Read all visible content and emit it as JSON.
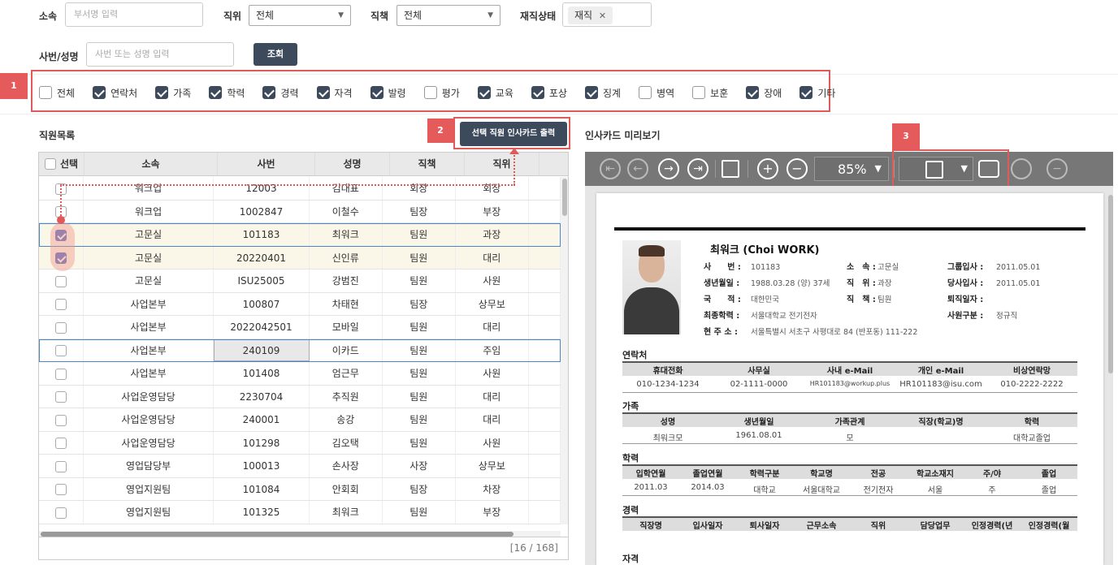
{
  "search": {
    "dept_label": "소속",
    "dept_placeholder": "부서명 입력",
    "position_label": "직위",
    "position_value": "전체",
    "duty_label": "직책",
    "duty_value": "전체",
    "status_label": "재직상태",
    "status_chip": "재직",
    "status_chip_close": "✕",
    "emp_label": "사번/성명",
    "emp_placeholder": "사번 또는 성명 입력",
    "search_button": "조회"
  },
  "filters": [
    {
      "label": "전체",
      "checked": false
    },
    {
      "label": "연락처",
      "checked": true
    },
    {
      "label": "가족",
      "checked": true
    },
    {
      "label": "학력",
      "checked": true
    },
    {
      "label": "경력",
      "checked": true
    },
    {
      "label": "자격",
      "checked": true
    },
    {
      "label": "발령",
      "checked": true
    },
    {
      "label": "평가",
      "checked": false
    },
    {
      "label": "교육",
      "checked": true
    },
    {
      "label": "포상",
      "checked": true
    },
    {
      "label": "징계",
      "checked": true
    },
    {
      "label": "병역",
      "checked": false
    },
    {
      "label": "보훈",
      "checked": false
    },
    {
      "label": "장애",
      "checked": true
    },
    {
      "label": "기타",
      "checked": true
    }
  ],
  "callouts": {
    "one": "1",
    "two": "2",
    "three": "3"
  },
  "list": {
    "title": "직원목록",
    "print_button": "선택 직원 인사카드 출력",
    "columns": [
      "선택",
      "소속",
      "사번",
      "성명",
      "직책",
      "직위"
    ],
    "rows": [
      {
        "dept": "워크업",
        "id": "12003",
        "name": "김대표",
        "duty": "회장",
        "pos": "회장",
        "checked": false
      },
      {
        "dept": "워크업",
        "id": "1002847",
        "name": "이철수",
        "duty": "팀장",
        "pos": "부장",
        "checked": false
      },
      {
        "dept": "고문실",
        "id": "101183",
        "name": "최워크",
        "duty": "팀원",
        "pos": "과장",
        "checked": true
      },
      {
        "dept": "고문실",
        "id": "20220401",
        "name": "신인류",
        "duty": "팀원",
        "pos": "대리",
        "checked": true
      },
      {
        "dept": "고문실",
        "id": "ISU25005",
        "name": "강범진",
        "duty": "팀원",
        "pos": "사원",
        "checked": false
      },
      {
        "dept": "사업본부",
        "id": "100807",
        "name": "차태현",
        "duty": "팀장",
        "pos": "상무보",
        "checked": false
      },
      {
        "dept": "사업본부",
        "id": "2022042501",
        "name": "모바일",
        "duty": "팀원",
        "pos": "대리",
        "checked": false
      },
      {
        "dept": "사업본부",
        "id": "240109",
        "name": "이카드",
        "duty": "팀원",
        "pos": "주임",
        "checked": false
      },
      {
        "dept": "사업본부",
        "id": "101408",
        "name": "엄근무",
        "duty": "팀원",
        "pos": "사원",
        "checked": false
      },
      {
        "dept": "사업운영담당",
        "id": "2230704",
        "name": "추직원",
        "duty": "팀원",
        "pos": "대리",
        "checked": false
      },
      {
        "dept": "사업운영담당",
        "id": "240001",
        "name": "송강",
        "duty": "팀원",
        "pos": "대리",
        "checked": false
      },
      {
        "dept": "사업운영담당",
        "id": "101298",
        "name": "김오택",
        "duty": "팀원",
        "pos": "사원",
        "checked": false
      },
      {
        "dept": "영업담당부",
        "id": "100013",
        "name": "손사장",
        "duty": "사장",
        "pos": "상무보",
        "checked": false
      },
      {
        "dept": "영업지원팀",
        "id": "101084",
        "name": "안회회",
        "duty": "팀장",
        "pos": "차장",
        "checked": false
      },
      {
        "dept": "영업지원팀",
        "id": "101325",
        "name": "최워크",
        "duty": "팀원",
        "pos": "부장",
        "checked": false
      }
    ],
    "pager": "[16 / 168]"
  },
  "preview": {
    "title": "인사카드 미리보기",
    "zoom": "85%",
    "card": {
      "name": "최워크 (Choi WORK)",
      "fields": [
        {
          "k": "사　　번 :",
          "v": "101183"
        },
        {
          "k": "생년월일 :",
          "v": "1988.03.28 (양) 37세"
        },
        {
          "k": "국　　적 :",
          "v": "대한민국"
        },
        {
          "k": "최종학력 :",
          "v": "서울대학교 전기전자"
        },
        {
          "k": "현 주 소 :",
          "v": "서울특별시 서초구 사평대로 84 (반포동) 111-222"
        }
      ],
      "fields2": [
        {
          "k": "소　속 :",
          "v": "고문실"
        },
        {
          "k": "직　위 :",
          "v": "과장"
        },
        {
          "k": "직　책 :",
          "v": "팀원"
        }
      ],
      "fields3": [
        {
          "k": "그룹입사 :",
          "v": "2011.05.01"
        },
        {
          "k": "당사입사 :",
          "v": "2011.05.01"
        },
        {
          "k": "퇴직일자 :",
          "v": ""
        },
        {
          "k": "사원구분 :",
          "v": "정규직"
        }
      ],
      "contact": {
        "title": "연락처",
        "headers": [
          "휴대전화",
          "사무실",
          "사내 e-Mail",
          "개인 e-Mail",
          "비상연락망"
        ],
        "values": [
          "010-1234-1234",
          "02-1111-0000",
          "HR101183@workup.plus",
          "HR101183@isu.com",
          "010-2222-2222"
        ]
      },
      "family": {
        "title": "가족",
        "headers": [
          "성명",
          "생년월일",
          "가족관계",
          "직장(학교)명",
          "학력"
        ],
        "values": [
          "최워크모",
          "1961.08.01",
          "모",
          "",
          "대학교졸업"
        ]
      },
      "education": {
        "title": "학력",
        "headers": [
          "입학연월",
          "졸업연월",
          "학력구분",
          "학교명",
          "전공",
          "학교소재지",
          "주/야",
          "졸업"
        ],
        "values": [
          "2011.03",
          "2014.03",
          "대학교",
          "서울대학교",
          "전기전자",
          "서울",
          "주",
          "졸업"
        ]
      },
      "career": {
        "title": "경력",
        "headers": [
          "직장명",
          "입사일자",
          "퇴사일자",
          "근무소속",
          "직위",
          "담당업무",
          "인정경력(년",
          "인정경력(월"
        ]
      },
      "cert": {
        "title": "자격"
      }
    }
  }
}
